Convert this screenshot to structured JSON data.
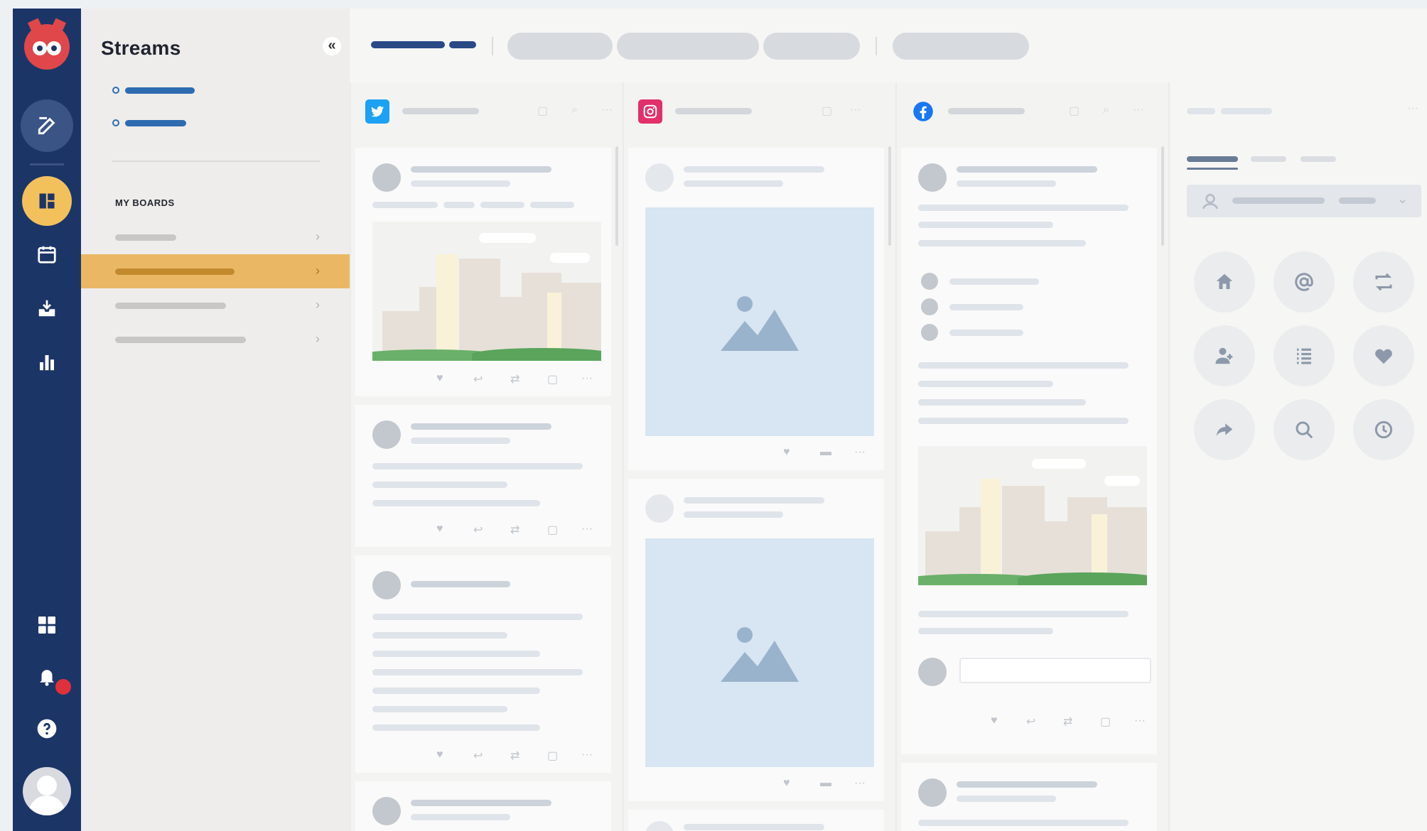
{
  "nav": {
    "items": [
      "compose-icon",
      "streams-icon",
      "calendar-icon",
      "inbox-icon",
      "analytics-icon",
      "apps-icon",
      "bell-icon",
      "help-icon"
    ],
    "accent": "#f3c15c",
    "rail_color": "#1c3567",
    "notification_color": "#e0303a"
  },
  "streams_panel": {
    "title": "Streams",
    "collapse_label": "«",
    "section_label": "MY BOARDS",
    "boards_selected_index": 1
  },
  "columns": [
    {
      "network": "twitter",
      "icon_label": "t",
      "color": "#1da1f2"
    },
    {
      "network": "instagram",
      "icon_label": "◎",
      "color": "#e1306c"
    },
    {
      "network": "facebook",
      "icon_label": "f",
      "color": "#1877f2"
    }
  ],
  "actions": {
    "like": "♥",
    "reply": "↩",
    "retweet": "⇄",
    "save": "▢",
    "more": "···",
    "comment": "▬"
  },
  "right_panel": {
    "buttons": [
      "home-icon",
      "mention-icon",
      "retweet-icon",
      "add-user-icon",
      "list-icon",
      "heart-icon",
      "share-icon",
      "search-icon",
      "clock-icon"
    ]
  }
}
